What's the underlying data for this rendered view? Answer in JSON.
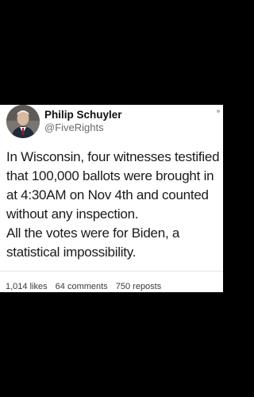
{
  "post": {
    "author_name": "Philip Schuyler",
    "author_handle": "@FiveRights",
    "text_lines": [
      "In Wisconsin, four witnesses testified",
      "that 100,000 ballots were brought in",
      "at 4:30AM on Nov 4th and counted",
      "without any inspection.",
      "All the votes were for Biden, a",
      "statistical impossibility."
    ],
    "stats": {
      "likes": "1,014 likes",
      "comments": "64 comments",
      "reposts": "750 reposts"
    }
  },
  "colors": {
    "background": "#000000",
    "card": "#ffffff",
    "text": "#1a1a1a",
    "handle": "#6b6b6b"
  },
  "icons": {
    "avatar": "profile-photo",
    "more": "more-dot-icon"
  }
}
